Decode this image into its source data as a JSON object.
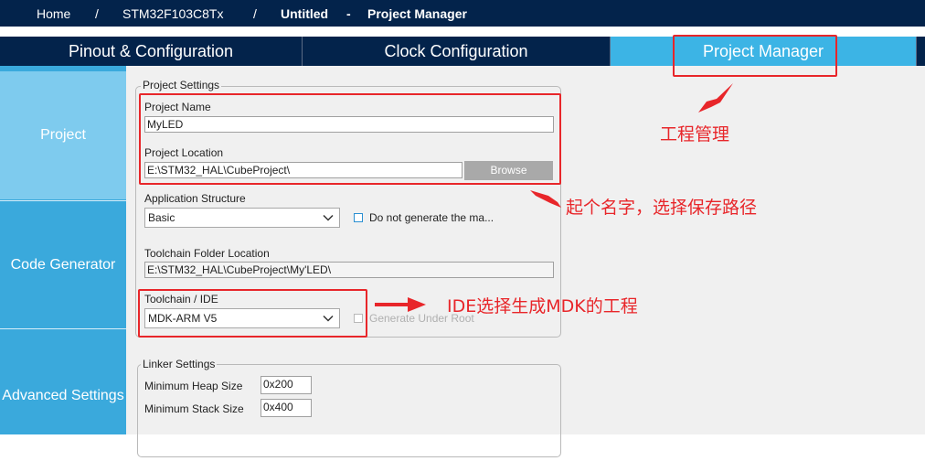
{
  "breadcrumb": {
    "home": "Home",
    "sep1": "/",
    "chip": "STM32F103C8Tx",
    "sep2": "/",
    "project": "Untitled",
    "sep3": "-",
    "page": "Project Manager"
  },
  "tabs": [
    {
      "label": "Pinout & Configuration"
    },
    {
      "label": "Clock Configuration"
    },
    {
      "label": "Project Manager"
    }
  ],
  "sidebar": {
    "items": [
      {
        "label": "Project"
      },
      {
        "label": "Code Generator"
      },
      {
        "label": "Advanced Settings"
      }
    ]
  },
  "project_settings": {
    "legend": "Project Settings",
    "project_name_label": "Project Name",
    "project_name_value": "MyLED",
    "project_location_label": "Project Location",
    "project_location_value": "E:\\STM32_HAL\\CubeProject\\",
    "browse_label": "Browse",
    "app_structure_label": "Application Structure",
    "app_structure_value": "Basic",
    "do_not_generate_label": "Do not generate the ma...",
    "toolchain_folder_label": "Toolchain Folder Location",
    "toolchain_folder_value": "E:\\STM32_HAL\\CubeProject\\My'LED\\",
    "toolchain_ide_label": "Toolchain / IDE",
    "toolchain_ide_value": "MDK-ARM V5",
    "generate_under_root_label": "Generate Under Root"
  },
  "linker_settings": {
    "legend": "Linker Settings",
    "heap_label": "Minimum Heap Size",
    "heap_value": "0x200",
    "stack_label": "Minimum Stack Size",
    "stack_value": "0x400"
  },
  "annotations": {
    "project_manager_note": "工程管理",
    "name_location_note": "起个名字，选择保存路径",
    "ide_note": "IDE选择生成MDK的工程"
  },
  "colors": {
    "nav_dark": "#03234b",
    "tab_active": "#3cb4e5",
    "sidebar": "#3aa9dc",
    "sidebar_active": "#7ecbee",
    "annotation_red": "#e8262a"
  }
}
